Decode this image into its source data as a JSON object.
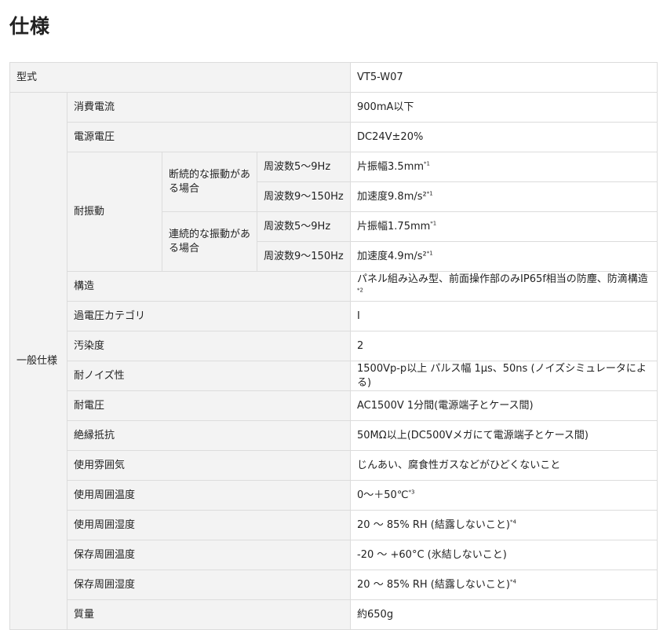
{
  "page": {
    "title": "仕様"
  },
  "spec": {
    "model": {
      "label": "型式",
      "value": "VT5-W07"
    },
    "general_label": "一般仕様",
    "consumption_current": {
      "label": "消費電流",
      "value": "900mA以下"
    },
    "supply_voltage": {
      "label": "電源電圧",
      "value": "DC24V±20%"
    },
    "vibration": {
      "label": "耐振動",
      "intermittent": {
        "label": "断続的な振動がある場合",
        "low": {
          "freq": "周波数5～9Hz",
          "value": "片振幅3.5mm",
          "note": "*1"
        },
        "high": {
          "freq": "周波数9～150Hz",
          "value": "加速度9.8m/s²",
          "note": "*1"
        }
      },
      "continuous": {
        "label": "連続的な振動がある場合",
        "low": {
          "freq": "周波数5～9Hz",
          "value": "片振幅1.75mm",
          "note": "*1"
        },
        "high": {
          "freq": "周波数9～150Hz",
          "value": "加速度4.9m/s²",
          "note": "*1"
        }
      }
    },
    "structure": {
      "label": "構造",
      "value": "パネル組み込み型、前面操作部のみIP65f相当の防塵、防滴構造",
      "note": "*2"
    },
    "overvoltage_category": {
      "label": "過電圧カテゴリ",
      "value": "Ⅰ"
    },
    "pollution_degree": {
      "label": "汚染度",
      "value": "2"
    },
    "noise_immunity": {
      "label": "耐ノイズ性",
      "value": "1500Vp-p以上 パルス幅 1μs、50ns (ノイズシミュレータによる)"
    },
    "withstand_voltage": {
      "label": "耐電圧",
      "value": "AC1500V 1分間(電源端子とケース間)"
    },
    "insulation_resistance": {
      "label": "絶縁抵抗",
      "value": "50MΩ以上(DC500Vメガにて電源端子とケース間)"
    },
    "operating_atmosphere": {
      "label": "使用雰囲気",
      "value": "じんあい、腐食性ガスなどがひどくないこと"
    },
    "operating_temperature": {
      "label": "使用周囲温度",
      "value": "0～＋50℃",
      "note": "*3"
    },
    "operating_humidity": {
      "label": "使用周囲湿度",
      "value": "20 ～ 85% RH (結露しないこと)",
      "note": "*4"
    },
    "storage_temperature": {
      "label": "保存周囲温度",
      "value": "-20 ～ +60°C (氷結しないこと)"
    },
    "storage_humidity": {
      "label": "保存周囲湿度",
      "value": "20 ～ 85% RH (結露しないこと)",
      "note": "*4"
    },
    "weight": {
      "label": "質量",
      "value": "約650g"
    }
  }
}
